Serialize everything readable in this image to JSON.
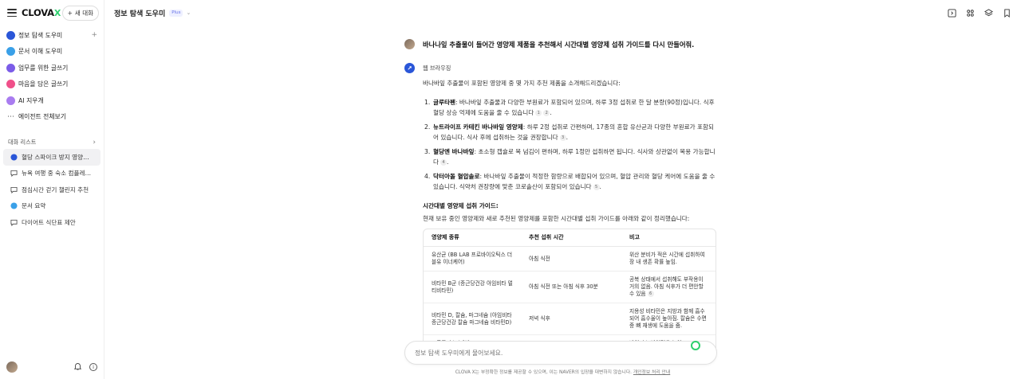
{
  "sidebar": {
    "logo_main": "CLOVA",
    "logo_x": "X",
    "new_chat_label": "새 대화",
    "agents": [
      {
        "label": "정보 탐색 도우미",
        "color": "#2a56d8"
      },
      {
        "label": "문서 이해 도우미",
        "color": "#3aa0e8"
      },
      {
        "label": "업무를 위한 글쓰기",
        "color": "#7b5ce8"
      },
      {
        "label": "마음을 담은 글쓰기",
        "color": "#f0508a"
      },
      {
        "label": "AI 지우개",
        "color": "#a97cf0"
      }
    ],
    "all_agents_label": "에이전트 전체보기",
    "list_title": "대화 리스트",
    "conversations": [
      {
        "label": "혈당 스파이크 방지 영양제 ...",
        "icon": "agent-icon",
        "active": true
      },
      {
        "label": "뉴욕 여행 중 숙소 컴플레인 ...",
        "icon": "chat-icon",
        "active": false
      },
      {
        "label": "점심시간 걷기 챌린지 추천",
        "icon": "chat-icon",
        "active": false
      },
      {
        "label": "문서 요약",
        "icon": "doc-agent-icon",
        "active": false
      },
      {
        "label": "다이어트 식단표 제안",
        "icon": "chat-icon",
        "active": false
      }
    ]
  },
  "header": {
    "agent_title": "정보 탐색 도우미",
    "badge": "Plus"
  },
  "chat": {
    "user_message": "바나나잎 추출물이 들어간 영양제 제품을 추천해서 시간대별 영양제 섭취 가이드를 다시 만들어줘.",
    "bot_label": "웹 브라우징",
    "intro": "바나바잎 추출물이 포함된 영양제 중 몇 가지 추천 제품을 소개해드리겠습니다:",
    "products": [
      {
        "num": "1.",
        "name": "글루타펜",
        "desc": ": 바나바잎 추출물과 다양한 부원료가 포함되어 있으며, 하루 3정 섭취로 한 달 분량(90정)입니다. 식후 혈당 상승 억제에 도움을 줄 수 있습니다",
        "cites": [
          "1",
          "2"
        ]
      },
      {
        "num": "2.",
        "name": "뉴트라이프 카테킨 바나바잎 영양제",
        "desc": ": 하루 2정 섭취로 간편하며, 17종의 혼합 유산균과 다양한 부원료가 포함되어 있습니다. 식사 후에 섭취하는 것을 권장합니다",
        "cites": [
          "3"
        ]
      },
      {
        "num": "3.",
        "name": "혈당엔 바나바잎",
        "desc": ": 초소형 캡슐로 목 넘김이 편하며, 하루 1정만 섭취하면 됩니다. 식사와 상관없이 복용 가능합니다",
        "cites": [
          "4"
        ]
      },
      {
        "num": "4.",
        "name": "닥터아돌 혈압솔로",
        "desc": ": 바나바잎 추출물이 적정한 함량으로 배합되어 있으며, 혈압 관리와 혈당 케어에 도움을 줄 수 있습니다. 식약처 권장량에 맞춘 코로솔산이 포함되어 있습니다",
        "cites": [
          "5"
        ]
      }
    ],
    "section_title": "시간대별 영양제 섭취 가이드:",
    "section_intro": "현재 보유 중인 영양제와 새로 추천된 영양제를 포함한 시간대별 섭취 가이드를 아래와 같이 정리했습니다:",
    "table": {
      "headers": [
        "영양제 종류",
        "추천 섭취 시간",
        "비고"
      ],
      "rows": [
        {
          "c1": "유산균 (BB LAB 프로바이오틱스 더블유 이너케어)",
          "c2": "아침 식전",
          "c3": "위산 분비가 적은 시간에 섭취하여 장 내 생존 확률 높임.",
          "cite": ""
        },
        {
          "c1": "비타민 B군 (종근당건강 아임비타 멀티비타민)",
          "c2": "아침 식전 또는 아침 식후 30분",
          "c3": "공복 상태에서 섭취해도 부작용이 거의 없음. 아침 식후가 더 편안할 수 있음",
          "cite": "6"
        },
        {
          "c1": "비타민 D, 칼슘, 마그네슘 (아임비타 종근당건강 칼슘 마그네슘 비타민D)",
          "c2": "저녁 식후",
          "c3": "지용성 비타민은 지방과 함께 흡수되어 흡수율이 높아짐. 칼슘은 수면 중 뼈 재생에 도움을 줌.",
          "cite": ""
        },
        {
          "c1": "프로폴리스 (에버 ...",
          "c2": "",
          "c3": "바이러스 방어력을 높여 ...",
          "cite": ""
        }
      ]
    }
  },
  "composer": {
    "placeholder": "정보 탐색 도우미에게 물어보세요."
  },
  "footer": {
    "disclaimer": "CLOVA X는 부정확한 정보를 제공할 수 있으며, 이는 NAVER의 입장을 대변하지 않습니다.",
    "privacy_link": "개인정보 처리 안내"
  },
  "colors": {
    "accent_green": "#2dcf6d",
    "agent_blue": "#2a56d8",
    "badge_purple": "#6570e8"
  }
}
